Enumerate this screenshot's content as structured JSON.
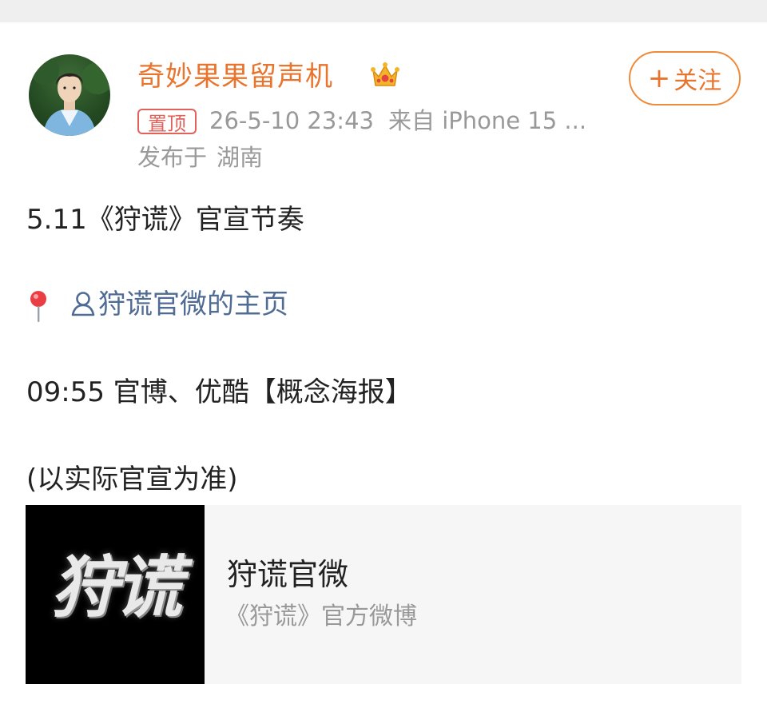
{
  "post": {
    "username": "奇妙果果留声机",
    "crown_icon": "crown-icon",
    "follow_label": "关注",
    "pinned_label": "置顶",
    "timestamp": "26-5-10 23:43",
    "source": "来自 iPhone 15 ...",
    "location_prefix": "发布于",
    "location": "湖南",
    "text": {
      "line1": "5.11《狩谎》官宣节奏",
      "link_label": "狩谎官微的主页",
      "line3": "09:55 官博、优酷【概念海报】",
      "line4": "(以实际官宣为准)"
    }
  },
  "card": {
    "thumb_text": "狩谎",
    "title": "狩谎官微",
    "subtitle": "《狩谎》官方微博"
  },
  "colors": {
    "accent": "#e8742d",
    "link": "#506b94",
    "pinned": "#e0625a",
    "meta": "#999999"
  }
}
